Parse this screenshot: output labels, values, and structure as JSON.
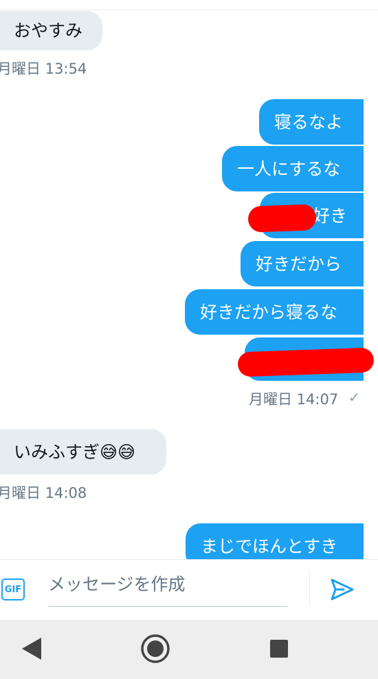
{
  "messages": [
    {
      "id": "m0",
      "text": "おやすみ"
    },
    {
      "id": "m1",
      "text": "寝るなよ"
    },
    {
      "id": "m2",
      "text": "一人にするな"
    },
    {
      "id": "m3",
      "text": "好き"
    },
    {
      "id": "m4",
      "text": "好きだから"
    },
    {
      "id": "m5",
      "text": "好きだから寝るな"
    },
    {
      "id": "m6",
      "text": "いみふすぎ😅😅"
    },
    {
      "id": "m7",
      "text": "まじでほんとすき"
    }
  ],
  "timestamps": {
    "t1": "月曜日 13:54",
    "t2": "月曜日 14:07",
    "t3": "月曜日 14:08"
  },
  "status": {
    "read_mark": "✓"
  },
  "composer": {
    "gif_label": "GIF",
    "placeholder": "メッセージを作成"
  },
  "icons": [
    "gif-icon",
    "send-icon",
    "back-icon",
    "home-icon",
    "recents-icon"
  ],
  "colors": {
    "accent": "#1da1f2",
    "incoming_bubble": "#e6ecf0",
    "redaction": "#ff0000"
  }
}
